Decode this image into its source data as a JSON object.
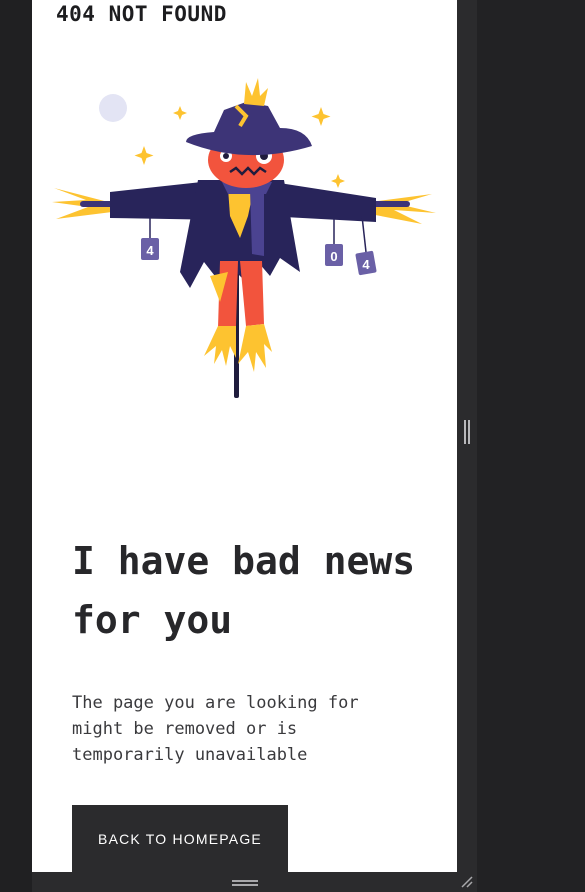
{
  "header": {
    "title": "404 NOT FOUND"
  },
  "illustration": {
    "name": "scarecrow",
    "can_labels": [
      "4",
      "0",
      "4"
    ],
    "colors": {
      "hat": "#3d3477",
      "face": "#f2543d",
      "straw": "#fdc330",
      "coat": "#28245a",
      "scarf": "#4b4391",
      "moon": "#e3e4f4"
    }
  },
  "main": {
    "headline": "I have bad news for you",
    "description": "The page you are looking for might be removed or is temporarily unavailable",
    "cta_label": "BACK TO HOMEPAGE"
  },
  "colors": {
    "page_bg": "#ffffff",
    "frame_bg": "#202022",
    "button_bg": "#2b2b2d",
    "text": "#27272a"
  }
}
